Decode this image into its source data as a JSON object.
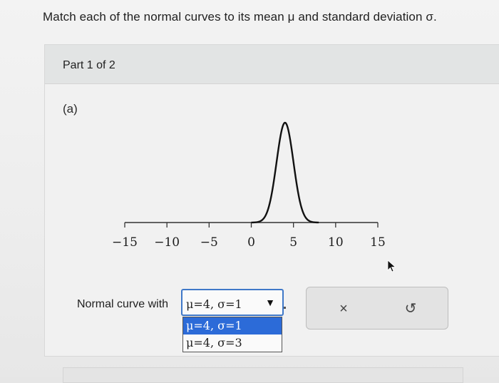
{
  "question": {
    "text": "Match each of the normal curves to its mean μ and standard deviation σ."
  },
  "part": {
    "label": "Part 1 of 2"
  },
  "subpart": {
    "label": "(a)"
  },
  "chart_data": {
    "type": "line",
    "title": "",
    "xlabel": "",
    "ylabel": "",
    "x_ticks": [
      -15,
      -10,
      -5,
      0,
      5,
      10,
      15
    ],
    "x_tick_labels": [
      "−15",
      "−10",
      "−5",
      "0",
      "5",
      "10",
      "15"
    ],
    "xlim": [
      -15,
      15
    ],
    "series": [
      {
        "mean": 4,
        "sd": 1
      }
    ],
    "grid": false
  },
  "answer": {
    "prefix": "Normal curve with",
    "selected_value": "μ=4,  σ=1",
    "options": [
      "μ=4,  σ=1",
      "μ=4,  σ=3"
    ],
    "selected_index": 0,
    "arrow_icon": "triangle-down-icon"
  },
  "actions": {
    "clear_symbol": "×",
    "undo_symbol": "↺",
    "clear_icon": "close-icon",
    "undo_icon": "undo-icon"
  }
}
